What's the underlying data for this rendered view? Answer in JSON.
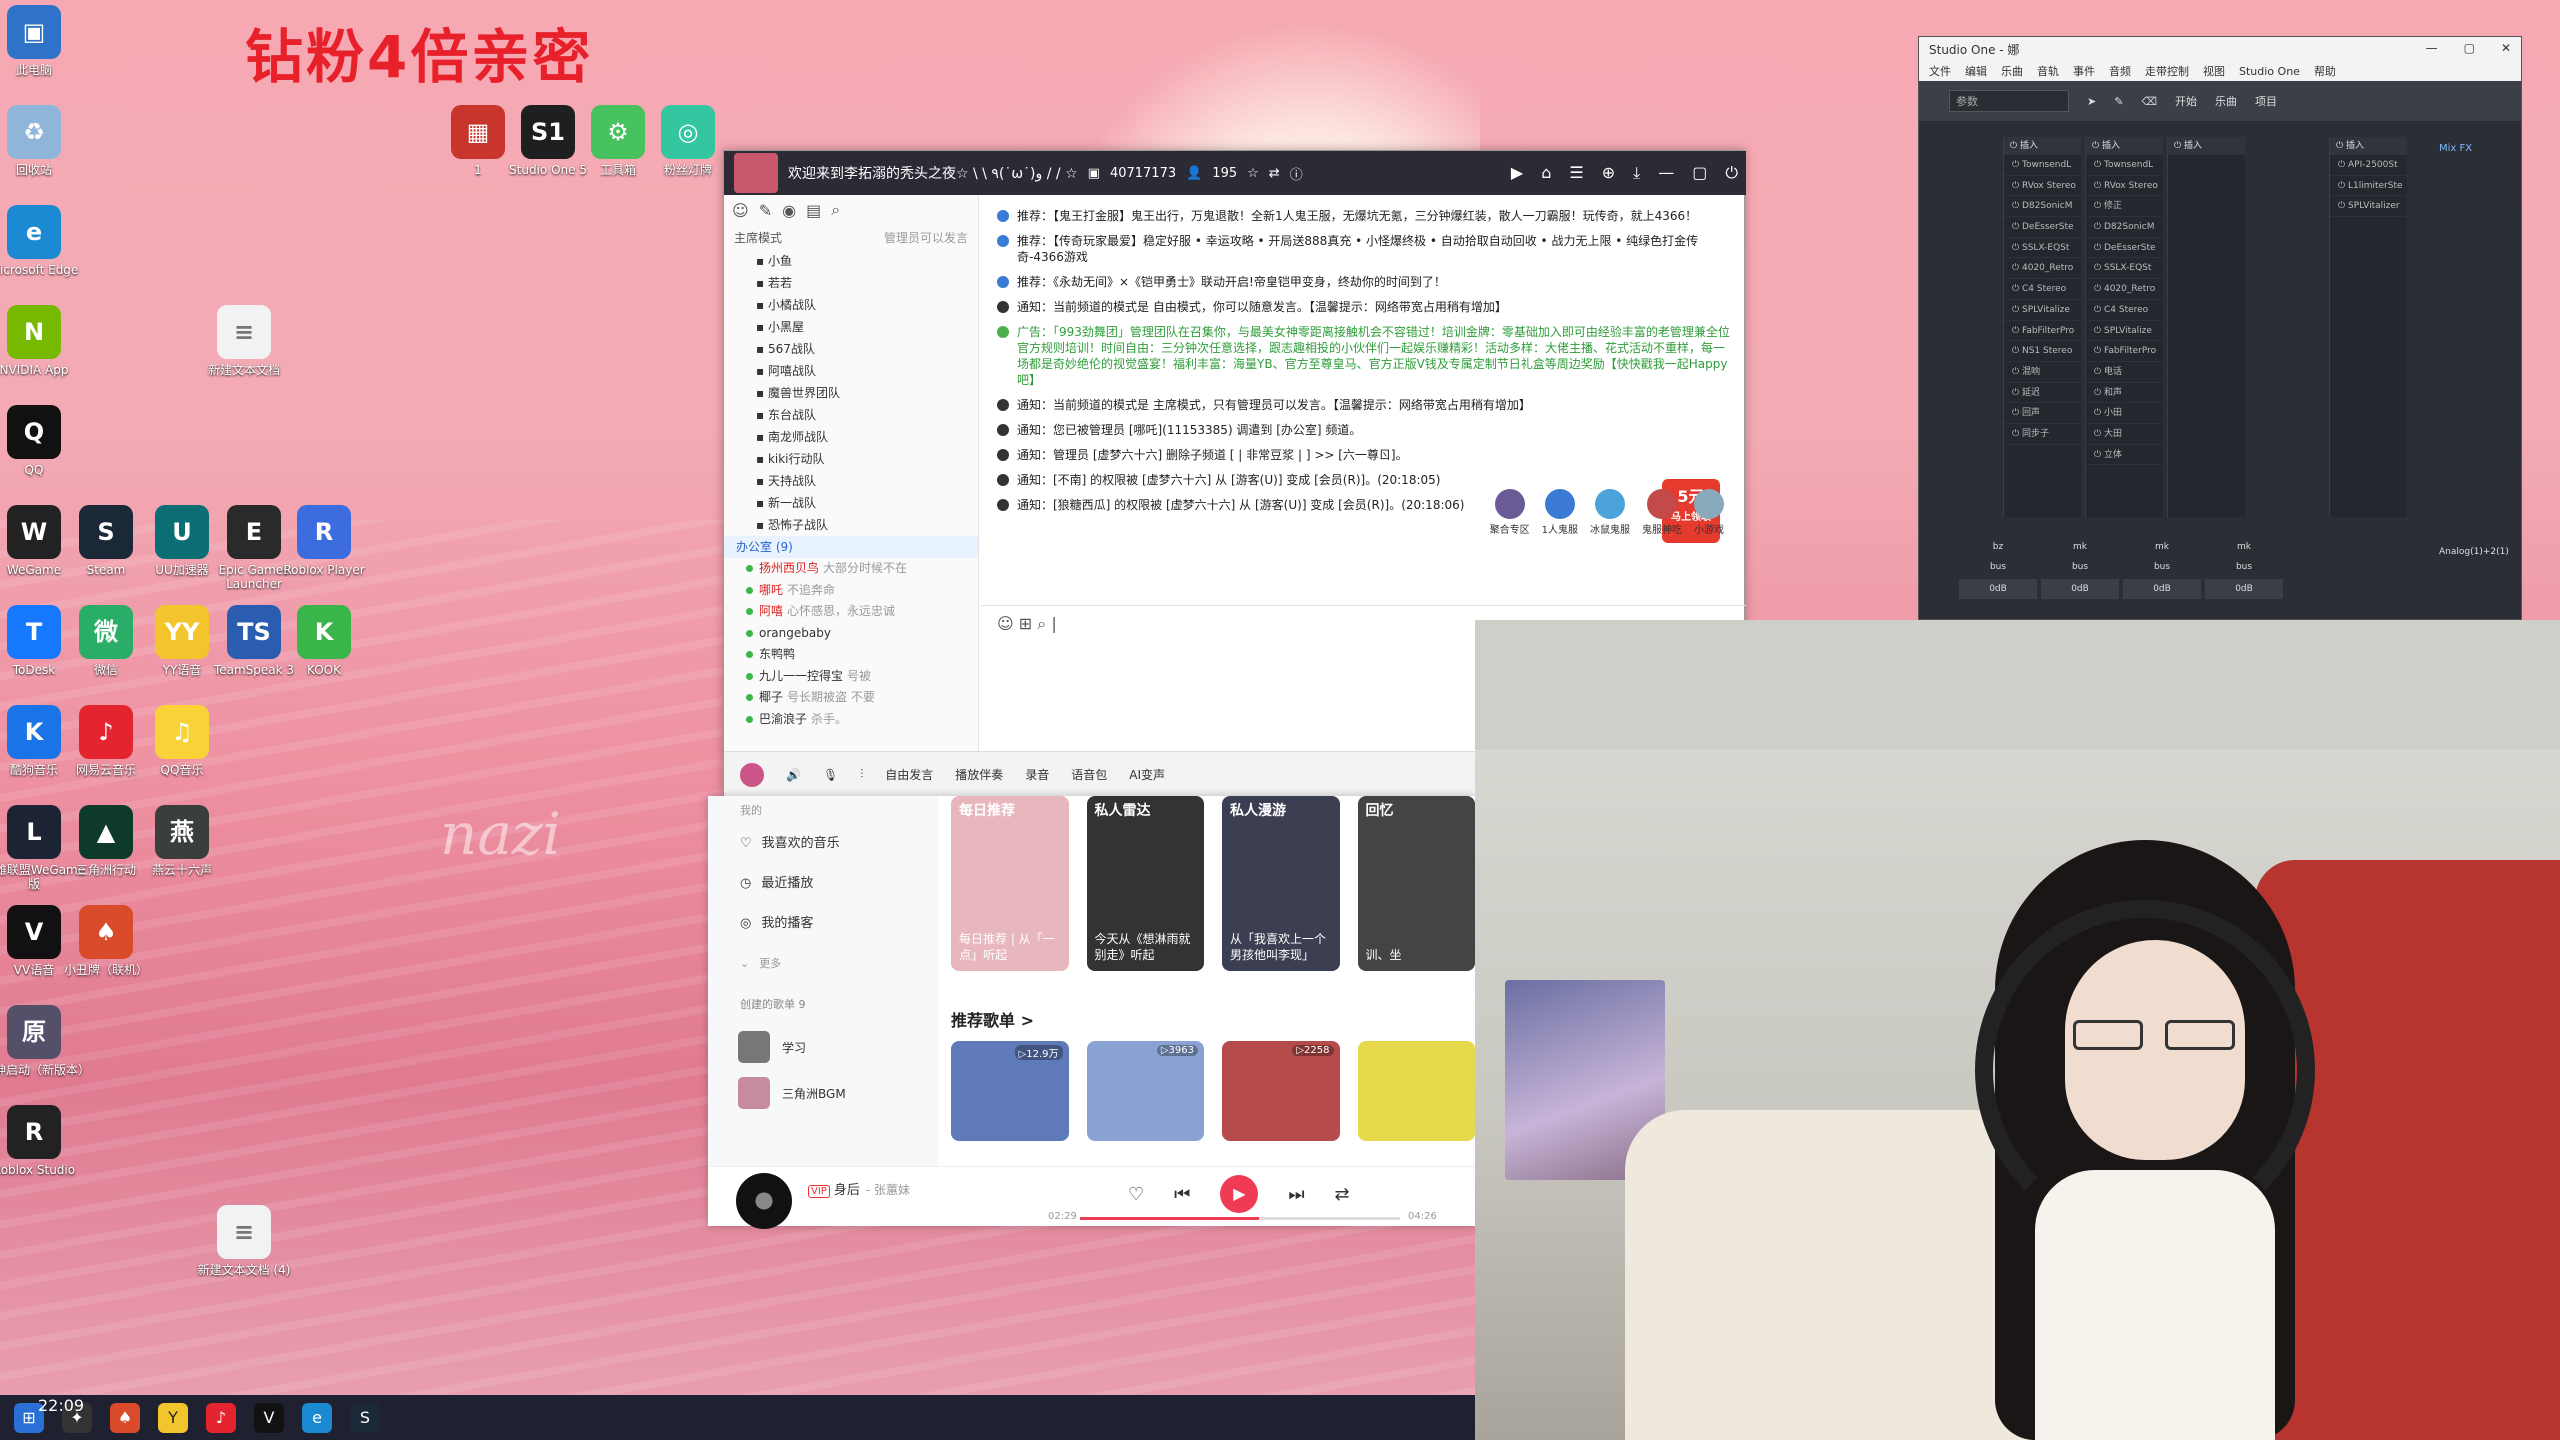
{
  "desktop": {
    "promo_text": "钻粉4倍亲密",
    "watermark": "nazi",
    "icons": [
      {
        "label": "此电脑",
        "color": "#2f73c9",
        "glyph": "▣"
      },
      {
        "label": "回收站",
        "color": "#8fb6d9",
        "glyph": "♻"
      },
      {
        "label": "Microsoft Edge",
        "color": "#1b8ad3",
        "glyph": "e"
      },
      {
        "label": "NVIDIA App",
        "color": "#76b900",
        "glyph": "N"
      },
      {
        "label": "QQ",
        "color": "#111111",
        "glyph": "Q"
      },
      {
        "label": "WeGame",
        "color": "#222222",
        "glyph": "W"
      },
      {
        "label": "Steam",
        "color": "#1b2838",
        "glyph": "S"
      },
      {
        "label": "UU加速器",
        "color": "#0b6e74",
        "glyph": "U"
      },
      {
        "label": "Epic Games Launcher",
        "color": "#2a2a2a",
        "glyph": "E"
      },
      {
        "label": "Roblox Player",
        "color": "#3c6ce0",
        "glyph": "R"
      },
      {
        "label": "ToDesk",
        "color": "#1677ff",
        "glyph": "T"
      },
      {
        "label": "微信",
        "color": "#2aae67",
        "glyph": "微"
      },
      {
        "label": "YY语音",
        "color": "#f3c52d",
        "glyph": "YY"
      },
      {
        "label": "TeamSpeak 3",
        "color": "#2a5db0",
        "glyph": "TS"
      },
      {
        "label": "KOOK",
        "color": "#39b54a",
        "glyph": "K"
      },
      {
        "label": "酷狗音乐",
        "color": "#1a74e8",
        "glyph": "K"
      },
      {
        "label": "网易云音乐",
        "color": "#e4252f",
        "glyph": "♪"
      },
      {
        "label": "QQ音乐",
        "color": "#f8d236",
        "glyph": "♫"
      },
      {
        "label": "英雄联盟WeGame版",
        "color": "#1c2434",
        "glyph": "L"
      },
      {
        "label": "三角洲行动",
        "color": "#0e3a2b",
        "glyph": "▲"
      },
      {
        "label": "燕云十六声",
        "color": "#3a3f3c",
        "glyph": "燕"
      },
      {
        "label": "VV语音",
        "color": "#111111",
        "glyph": "V"
      },
      {
        "label": "小丑牌（联机）",
        "color": "#d94b2a",
        "glyph": "♠"
      },
      {
        "label": "原神启动（新版本）",
        "color": "#55506a",
        "glyph": "原"
      },
      {
        "label": "Roblox Studio",
        "color": "#222222",
        "glyph": "R"
      },
      {
        "label": "新建文本文档",
        "color": "#f2f2f2",
        "glyph": "≡"
      },
      {
        "label": "新建文本文档 (4)",
        "color": "#f2f2f2",
        "glyph": "≡"
      },
      {
        "label": "1",
        "color": "#c8352d",
        "glyph": "▦"
      },
      {
        "label": "Studio One 5",
        "color": "#1f1f1f",
        "glyph": "S1"
      },
      {
        "label": "工具箱",
        "color": "#47c25f",
        "glyph": "⚙"
      },
      {
        "label": "粉丝灯牌",
        "color": "#34c6a0",
        "glyph": "◎"
      }
    ],
    "taskbar_time": "22:09"
  },
  "yy": {
    "title": "欢迎来到李拓溺的秃头之夜☆ \\ \\ ٩(˙ω˙)و / / ☆",
    "channel_id": "40717173",
    "online": "195",
    "mode_label": "主席模式",
    "mode_perm": "管理员可以发言",
    "channels": [
      "小鱼",
      "若若",
      "小橘战队",
      "小黑屋",
      "567战队",
      "阿嘻战队",
      "魔兽世界团队",
      "东台战队",
      "南龙师战队",
      "kiki行动队",
      "天持战队",
      "新一战队",
      "恐怖子战队"
    ],
    "office": "办公室",
    "office_count": "(9)",
    "users": [
      {
        "name": "扬州西贝鸟",
        "sig": "大部分时候不在",
        "red": true
      },
      {
        "name": "哪吒",
        "sig": "不追奔命",
        "red": true
      },
      {
        "name": "阿嘻",
        "sig": "心怀感恩，永远忠诚",
        "red": true
      },
      {
        "name": "orangebaby",
        "sig": "",
        "red": false
      },
      {
        "name": "东鸭鸭",
        "sig": "",
        "red": false
      },
      {
        "name": "九儿一一控得宝",
        "sig": "号被",
        "red": false
      },
      {
        "name": "椰子",
        "sig": "号长期被盗 不要",
        "red": false
      },
      {
        "name": "巴渝浪子",
        "sig": "杀手。",
        "red": false
      }
    ],
    "messages": [
      {
        "kind": "info",
        "text": "推荐：【鬼王打金服】鬼王出行，万鬼退散！全新1人鬼王服，无爆坑无氪，三分钟爆红装，散人一刀霸服！玩传奇，就上4366！"
      },
      {
        "kind": "info",
        "text": "推荐：【传奇玩家最爱】稳定好服 • 幸运攻略 • 开局送888真充 • 小怪爆终极 • 自动拾取自动回收 • 战力无上限 • 纯绿色打金传奇-4366游戏"
      },
      {
        "kind": "info",
        "text": "推荐：《永劫无间》×《铠甲勇士》联动开启!帝皇铠甲变身，终劫你的时间到了！"
      },
      {
        "kind": "plain",
        "text": "通知：当前频道的模式是 自由模式，你可以随意发言。【温馨提示：网络带宽占用稍有增加】"
      },
      {
        "kind": "ad",
        "text": "广告：「993劲舞团」管理团队在召集你，与最美女神零距离接触机会不容错过！培训金牌：零基础加入即可由经验丰富的老管理兼全位官方规则培训！时间自由：三分钟次任意选择，跟志趣相投的小伙伴们一起娱乐赚精彩！活动多样：大佬主播、花式活动不重样，每一场都是奇妙绝伦的视觉盛宴！福利丰富：海量YB、官方至尊皇马、官方正版V钱及专属定制节日礼盒等周边奖励【快快戳我一起Happy吧】"
      },
      {
        "kind": "plain",
        "text": "通知：当前频道的模式是 主席模式，只有管理员可以发言。【温馨提示：网络带宽占用稍有增加】"
      },
      {
        "kind": "plain",
        "text": "通知：您已被管理员 [哪吒](11153385) 调遣到 [办公室] 频道。"
      },
      {
        "kind": "plain",
        "text": "通知：管理员 [虚梦六十六] 删除子频道 [ | 非常豆浆 | ] >> [六一尊ㄖ]。"
      },
      {
        "kind": "plain",
        "text": "通知：[不南] 的权限被 [虚梦六十六] 从 [游客(U)] 变成 [会员(R)]。(20:18:05)"
      },
      {
        "kind": "plain",
        "text": "通知：[狼糖西瓜] 的权限被 [虚梦六十六] 从 [游客(U)] 变成 [会员(R)]。(20:18:06)"
      }
    ],
    "badge": {
      "amount": "5元",
      "label": "马上领取"
    },
    "fx": [
      "聚合专区",
      "1人鬼服",
      "冰鼠鬼服",
      "鬼服神吃",
      "小游戏"
    ],
    "bottom": [
      "自由发言",
      "播放伴奏",
      "录音",
      "语音包",
      "AI变声"
    ]
  },
  "music": {
    "side_head": "我的",
    "side_items": [
      "我喜欢的音乐",
      "最近播放",
      "我的播客",
      "更多"
    ],
    "playlist_head": "创建的歌单 9",
    "playlists": [
      "学习",
      "三角洲BGM"
    ],
    "cards": [
      {
        "top": "每日推荐",
        "cap": "每日推荐 | 从「一点」听起",
        "color": "#e8b7bd"
      },
      {
        "top": "私人雷达",
        "cap": "今天从《想淋雨就别走》听起",
        "color": "#333333"
      },
      {
        "top": "私人漫游",
        "cap": "从「我喜欢上一个男孩他叫李现」",
        "color": "#3c3f52"
      },
      {
        "top": "回忆",
        "cap": "训、坐",
        "color": "#444444"
      }
    ],
    "section": "推荐歌单 >",
    "covers": [
      {
        "count": "12.9万",
        "color": "#5f7ab8"
      },
      {
        "count": "3963",
        "color": "#8aa1d4"
      },
      {
        "count": "2258",
        "color": "#b64b4b"
      },
      {
        "count": "",
        "color": "#e6d94b"
      }
    ],
    "song": "身后",
    "artist": "- 张蕙妹",
    "vip": "VIP",
    "time_now": "02:29",
    "time_total": "04:26",
    "progress": 0.56
  },
  "studio": {
    "title": "Studio One - 娜",
    "menu": [
      "文件",
      "编辑",
      "乐曲",
      "音轨",
      "事件",
      "音频",
      "走带控制",
      "视图",
      "Studio One",
      "帮助"
    ],
    "preset": "参数",
    "start": "开始",
    "song_label": "乐曲",
    "project": "项目",
    "mixfx": "Mix FX",
    "columns": [
      {
        "head": "插入",
        "inserts": [
          "TownsendL",
          "RVox Stereo",
          "D82SonicM",
          "DeEsserSte",
          "SSLX-EQSt",
          "4020_Retro",
          "C4 Stereo",
          "SPLVitalize",
          "FabFilterPro",
          "NS1 Stereo",
          "混响",
          "延迟",
          "回声",
          "同步子"
        ]
      },
      {
        "head": "插入",
        "inserts": [
          "TownsendL",
          "RVox Stereo",
          "修正",
          "D82SonicM",
          "DeEsserSte",
          "SSLX-EQSt",
          "4020_Retro",
          "C4 Stereo",
          "SPLVitalize",
          "FabFilterPro",
          "电话",
          "和声",
          "小田",
          "大田",
          "立体"
        ]
      },
      {
        "head": "插入",
        "inserts": []
      },
      {
        "head": "插入",
        "inserts": [
          "API-2500St",
          "L1limiterSte",
          "SPLVitalizer"
        ]
      }
    ],
    "bus": [
      {
        "name": "bz",
        "label": "bus",
        "db": "0dB"
      },
      {
        "name": "mk",
        "label": "bus",
        "db": "0dB"
      },
      {
        "name": "mk",
        "label": "bus",
        "db": "0dB"
      },
      {
        "name": "mk",
        "label": "bus",
        "db": "0dB"
      }
    ],
    "analog": "Analog(1)+2(1)"
  }
}
